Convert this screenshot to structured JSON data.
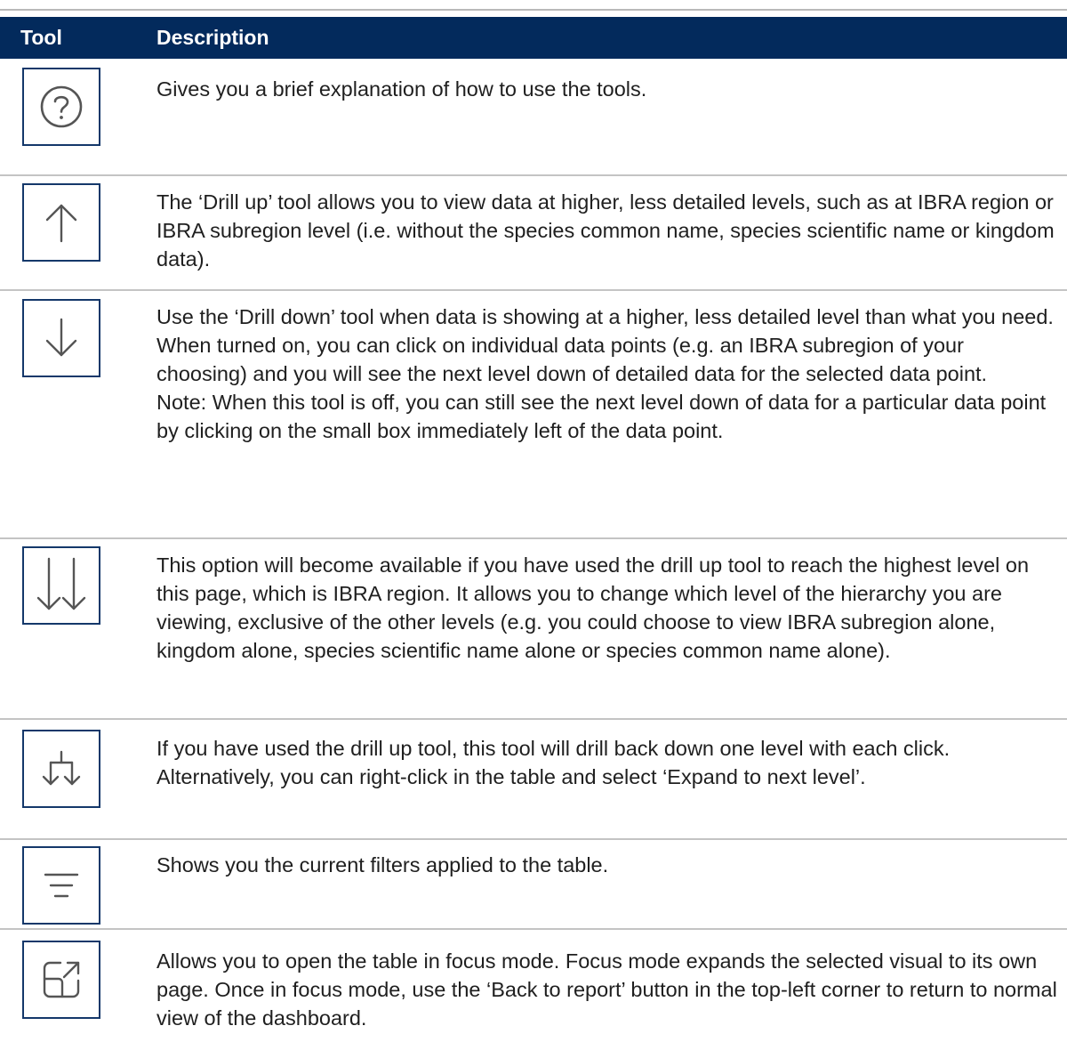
{
  "table": {
    "header": {
      "tool": "Tool",
      "description": "Description"
    },
    "rows": [
      {
        "icon": "help-icon",
        "lines": [
          "Gives you a brief explanation of how to use the tools."
        ]
      },
      {
        "icon": "arrow-up-icon",
        "lines": [
          "The ‘Drill up’ tool allows you to view data at higher, less detailed levels, such as at IBRA region or IBRA subregion level (i.e. without the species common name, species scientific name or kingdom data)."
        ]
      },
      {
        "icon": "arrow-down-icon",
        "lines": [
          "Use the ‘Drill down’ tool when data is showing at a higher, less detailed level than what you need. When turned on, you can click on individual data points (e.g. an IBRA subregion of your choosing) and you will see the next level down of detailed data for the selected data point.",
          "Note: When this tool is off, you can still see the next level down of data for a particular data point by clicking on the small box immediately left of the data point."
        ]
      },
      {
        "icon": "double-arrow-down-icon",
        "lines": [
          "This option will become available if you have used the drill up tool to reach the highest level on this page, which is IBRA region. It allows you to change which level of the hierarchy you are viewing, exclusive of the other levels (e.g. you could choose to view IBRA subregion alone, kingdom alone, species scientific name alone or species common name alone)."
        ]
      },
      {
        "icon": "expand-next-level-icon",
        "lines": [
          "If you have used the drill up tool, this tool will drill back down one level with each click. Alternatively, you can right-click in the table and select ‘Expand to next level’."
        ]
      },
      {
        "icon": "filter-icon",
        "lines": [
          "Shows you the current filters applied to the table."
        ]
      },
      {
        "icon": "focus-mode-icon",
        "lines": [
          "Allows you to open the table in focus mode. Focus mode expands the selected visual to its own page. Once in focus mode, use the ‘Back to report’ button in the top-left corner to return to normal view of the dashboard."
        ]
      }
    ]
  }
}
